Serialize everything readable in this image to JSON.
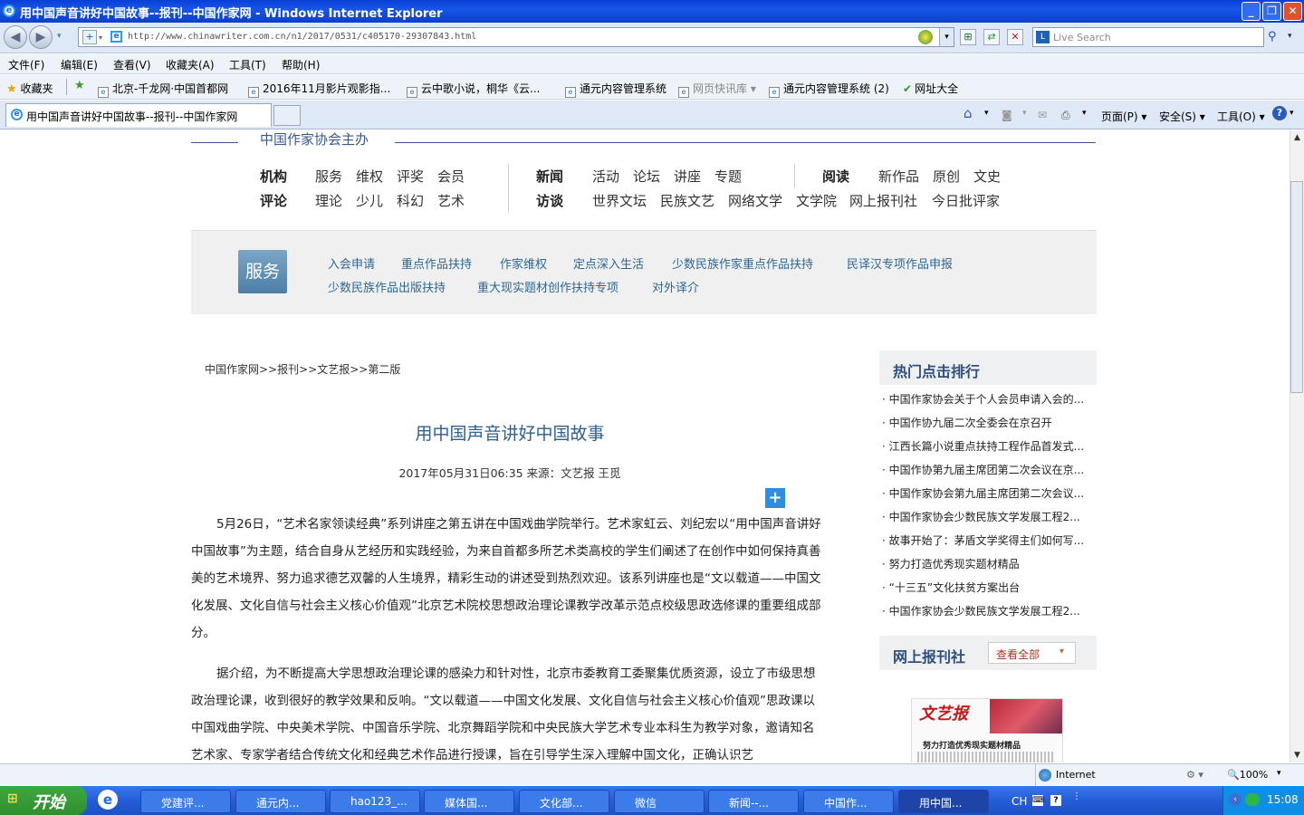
{
  "window": {
    "title": "用中国声音讲好中国故事--报刊--中国作家网 - Windows Internet Explorer"
  },
  "address": {
    "url": "http://www.chinawriter.com.cn/n1/2017/0531/c405170-29307843.html",
    "search_placeholder": "Live Search"
  },
  "menubar": [
    "文件(F)",
    "编辑(E)",
    "查看(V)",
    "收藏夹(A)",
    "工具(T)",
    "帮助(H)"
  ],
  "favorites": {
    "label": "收藏夹",
    "items": [
      "北京-千龙网·中国首都网",
      "2016年11月影片观影指...",
      "云中歌小说，桐华《云...",
      "通元内容管理系统",
      "网页快讯库",
      "通元内容管理系统 (2)",
      "网址大全"
    ]
  },
  "tab": {
    "title": "用中国声音讲好中国故事--报刊--中国作家网"
  },
  "commands": {
    "page": "页面(P)",
    "safety": "安全(S)",
    "tools": "工具(O)"
  },
  "site": {
    "org": "中国作家协会主办",
    "nav": [
      {
        "head": "机构",
        "links": [
          "服务",
          "维权",
          "评奖",
          "会员"
        ]
      },
      {
        "head": "评论",
        "links": [
          "理论",
          "少儿",
          "科幻",
          "艺术"
        ]
      },
      {
        "head": "新闻",
        "links": [
          "活动",
          "论坛",
          "讲座",
          "专题"
        ]
      },
      {
        "head": "访谈",
        "links": [
          "世界文坛",
          "民族文艺",
          "网络文学",
          "文学院",
          "网上报刊社",
          "今日批评家"
        ]
      },
      {
        "head": "阅读",
        "links": [
          "新作品",
          "原创",
          "文史"
        ]
      }
    ],
    "service": {
      "badge": "服务",
      "links": [
        "入会申请",
        "重点作品扶持",
        "作家维权",
        "定点深入生活",
        "少数民族作家重点作品扶持",
        "民译汉专项作品申报",
        "少数民族作品出版扶持",
        "重大现实题材创作扶持专项",
        "对外译介"
      ]
    }
  },
  "breadcrumb": "中国作家网>>报刊>>文艺报>>第二版",
  "article": {
    "title": "用中国声音讲好中国故事",
    "meta": "2017年05月31日06:35 来源：文艺报 王觅",
    "p1": "5月26日，“艺术名家领读经典”系列讲座之第五讲在中国戏曲学院举行。艺术家虹云、刘纪宏以“用中国声音讲好中国故事”为主题，结合自身从艺经历和实践经验，为来自首都多所艺术类高校的学生们阐述了在创作中如何保持真善美的艺术境界、努力追求德艺双馨的人生境界，精彩生动的讲述受到热烈欢迎。该系列讲座也是“文以载道——中国文化发展、文化自信与社会主义核心价值观”北京艺术院校思想政治理论课教学改革示范点校级思政选修课的重要组成部分。",
    "p2": "据介绍，为不断提高大学思想政治理论课的感染力和针对性，北京市委教育工委聚集优质资源，设立了市级思想政治理论课，收到很好的教学效果和反响。“文以载道——中国文化发展、文化自信与社会主义核心价值观”思政课以中国戏曲学院、中央美术学院、中国音乐学院、北京舞蹈学院和中央民族大学艺术专业本科生为教学对象，邀请知名艺术家、专家学者结合传统文化和经典艺术作品进行授课，旨在引导学生深入理解中国文化，正确认识艺"
  },
  "sidebar": {
    "hot_title": "热门点击排行",
    "hot": [
      "中国作家协会关于个人会员申请入会的...",
      "中国作协九届二次全委会在京召开",
      "江西长篇小说重点扶持工程作品首发式...",
      "中国作协第九届主席团第二次会议在京...",
      "中国作家协会第九届主席团第二次会议...",
      "中国作家协会少数民族文学发展工程2...",
      "故事开始了：茅盾文学奖得主们如何写...",
      "努力打造优秀现实题材精品",
      "“十三五”文化扶贫方案出台",
      "中国作家协会少数民族文学发展工程2..."
    ],
    "press_title": "网上报刊社",
    "press_more": "查看全部",
    "paper_name": "文艺报",
    "paper_headline": "努力打造优秀现实题材精品"
  },
  "status": {
    "zone": "Internet",
    "zoom": "100%"
  },
  "taskbar": {
    "start": "开始",
    "tasks": [
      "党建评...",
      "通元内...",
      "hao123_...",
      "媒体国...",
      "文化部...",
      "微信",
      "新闻--...",
      "中国作...",
      "用中国..."
    ],
    "ime": "CH",
    "clock": "15:08"
  }
}
